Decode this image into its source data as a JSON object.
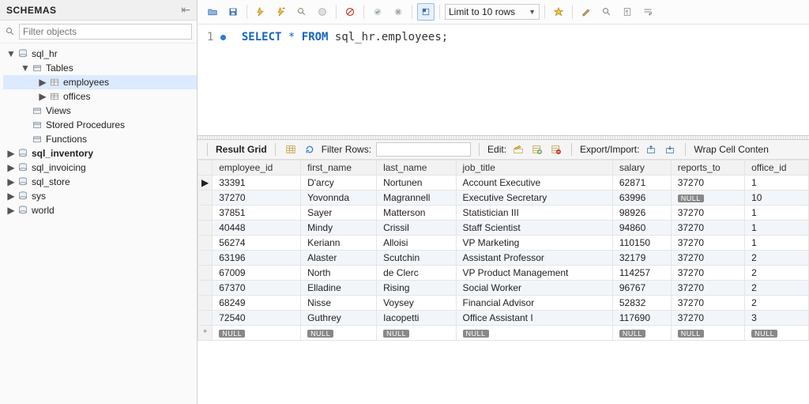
{
  "sidebar": {
    "title": "SCHEMAS",
    "filter_placeholder": "Filter objects",
    "tree": [
      {
        "id": "sql_hr",
        "label": "sql_hr",
        "depth": 0,
        "icon": "db",
        "expanded": true,
        "bold": false
      },
      {
        "id": "sql_hr.tables",
        "label": "Tables",
        "depth": 1,
        "icon": "folder",
        "expanded": true,
        "bold": false
      },
      {
        "id": "sql_hr.tables.employees",
        "label": "employees",
        "depth": 2,
        "icon": "table",
        "expanded": false,
        "bold": false,
        "selected": true,
        "twisty": true
      },
      {
        "id": "sql_hr.tables.offices",
        "label": "offices",
        "depth": 2,
        "icon": "table",
        "expanded": false,
        "bold": false,
        "twisty": true
      },
      {
        "id": "sql_hr.views",
        "label": "Views",
        "depth": 1,
        "icon": "folder",
        "expanded": false,
        "bold": false
      },
      {
        "id": "sql_hr.sp",
        "label": "Stored Procedures",
        "depth": 1,
        "icon": "folder",
        "expanded": false,
        "bold": false
      },
      {
        "id": "sql_hr.fn",
        "label": "Functions",
        "depth": 1,
        "icon": "folder",
        "expanded": false,
        "bold": false
      },
      {
        "id": "sql_inventory",
        "label": "sql_inventory",
        "depth": 0,
        "icon": "db",
        "expanded": false,
        "bold": true,
        "twisty": true
      },
      {
        "id": "sql_invoicing",
        "label": "sql_invoicing",
        "depth": 0,
        "icon": "db",
        "expanded": false,
        "bold": false,
        "twisty": true
      },
      {
        "id": "sql_store",
        "label": "sql_store",
        "depth": 0,
        "icon": "db",
        "expanded": false,
        "bold": false,
        "twisty": true
      },
      {
        "id": "sys",
        "label": "sys",
        "depth": 0,
        "icon": "db",
        "expanded": false,
        "bold": false,
        "twisty": true
      },
      {
        "id": "world",
        "label": "world",
        "depth": 0,
        "icon": "db",
        "expanded": false,
        "bold": false,
        "twisty": true
      }
    ]
  },
  "editor": {
    "line_number": "1",
    "sql_tokens": [
      {
        "t": "SELECT",
        "c": "kw"
      },
      {
        "t": " ",
        "c": "sp"
      },
      {
        "t": "*",
        "c": "op"
      },
      {
        "t": " ",
        "c": "sp"
      },
      {
        "t": "FROM",
        "c": "kw"
      },
      {
        "t": " ",
        "c": "sp"
      },
      {
        "t": "sql_hr.employees;",
        "c": "ident"
      }
    ]
  },
  "toolbar": {
    "limit_label": "Limit to 10 rows"
  },
  "results": {
    "bar": {
      "result_grid": "Result Grid",
      "filter_rows": "Filter Rows:",
      "edit": "Edit:",
      "export_import": "Export/Import:",
      "wrap": "Wrap Cell Conten"
    },
    "columns": [
      "employee_id",
      "first_name",
      "last_name",
      "job_title",
      "salary",
      "reports_to",
      "office_id"
    ],
    "rows": [
      [
        "33391",
        "D'arcy",
        "Nortunen",
        "Account Executive",
        "62871",
        "37270",
        "1"
      ],
      [
        "37270",
        "Yovonnda",
        "Magrannell",
        "Executive Secretary",
        "63996",
        "NULL",
        "10"
      ],
      [
        "37851",
        "Sayer",
        "Matterson",
        "Statistician III",
        "98926",
        "37270",
        "1"
      ],
      [
        "40448",
        "Mindy",
        "Crissil",
        "Staff Scientist",
        "94860",
        "37270",
        "1"
      ],
      [
        "56274",
        "Keriann",
        "Alloisi",
        "VP Marketing",
        "110150",
        "37270",
        "1"
      ],
      [
        "63196",
        "Alaster",
        "Scutchin",
        "Assistant Professor",
        "32179",
        "37270",
        "2"
      ],
      [
        "67009",
        "North",
        "de Clerc",
        "VP Product Management",
        "114257",
        "37270",
        "2"
      ],
      [
        "67370",
        "Elladine",
        "Rising",
        "Social Worker",
        "96767",
        "37270",
        "2"
      ],
      [
        "68249",
        "Nisse",
        "Voysey",
        "Financial Advisor",
        "52832",
        "37270",
        "2"
      ],
      [
        "72540",
        "Guthrey",
        "Iacopetti",
        "Office Assistant I",
        "117690",
        "37270",
        "3"
      ]
    ],
    "null_row": [
      "NULL",
      "NULL",
      "NULL",
      "NULL",
      "NULL",
      "NULL",
      "NULL"
    ]
  },
  "chart_data": {
    "type": "table",
    "title": "sql_hr.employees",
    "columns": [
      "employee_id",
      "first_name",
      "last_name",
      "job_title",
      "salary",
      "reports_to",
      "office_id"
    ],
    "rows": [
      [
        33391,
        "D'arcy",
        "Nortunen",
        "Account Executive",
        62871,
        37270,
        1
      ],
      [
        37270,
        "Yovonnda",
        "Magrannell",
        "Executive Secretary",
        63996,
        null,
        10
      ],
      [
        37851,
        "Sayer",
        "Matterson",
        "Statistician III",
        98926,
        37270,
        1
      ],
      [
        40448,
        "Mindy",
        "Crissil",
        "Staff Scientist",
        94860,
        37270,
        1
      ],
      [
        56274,
        "Keriann",
        "Alloisi",
        "VP Marketing",
        110150,
        37270,
        1
      ],
      [
        63196,
        "Alaster",
        "Scutchin",
        "Assistant Professor",
        32179,
        37270,
        2
      ],
      [
        67009,
        "North",
        "de Clerc",
        "VP Product Management",
        114257,
        37270,
        2
      ],
      [
        67370,
        "Elladine",
        "Rising",
        "Social Worker",
        96767,
        37270,
        2
      ],
      [
        68249,
        "Nisse",
        "Voysey",
        "Financial Advisor",
        52832,
        37270,
        2
      ],
      [
        72540,
        "Guthrey",
        "Iacopetti",
        "Office Assistant I",
        117690,
        37270,
        3
      ]
    ]
  }
}
